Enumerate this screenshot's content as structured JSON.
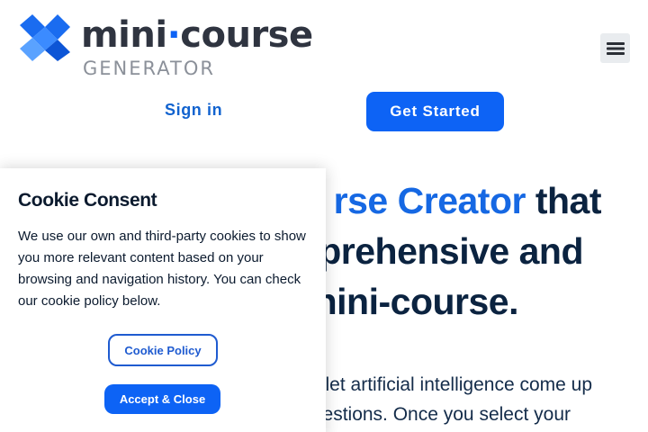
{
  "header": {
    "logo": {
      "word_main": "mini",
      "word_dot": "·",
      "word_end": "course",
      "subtitle": "GENERATOR"
    },
    "menu_icon": "hamburger-menu-icon"
  },
  "nav": {
    "signin_label": "Sign in",
    "get_started_label": "Get Started"
  },
  "hero": {
    "line1_accent": "rse Creator",
    "line1_rest": " that",
    "line2": "prehensive and",
    "line3": "nini-course.",
    "body_line1": "let artificial intelligence come up",
    "body_line2": "estions. Once you select your"
  },
  "cookie": {
    "title": "Cookie Consent",
    "text": "We use our own and third-party cookies to show you more relevant content based on your browsing and navigation history. You can check our cookie policy below.",
    "policy_label": "Cookie Policy",
    "accept_label": "Accept & Close"
  },
  "colors": {
    "brand_blue": "#0d63f5",
    "accent_blue": "#1668e3",
    "heading_navy": "#0b2340"
  }
}
